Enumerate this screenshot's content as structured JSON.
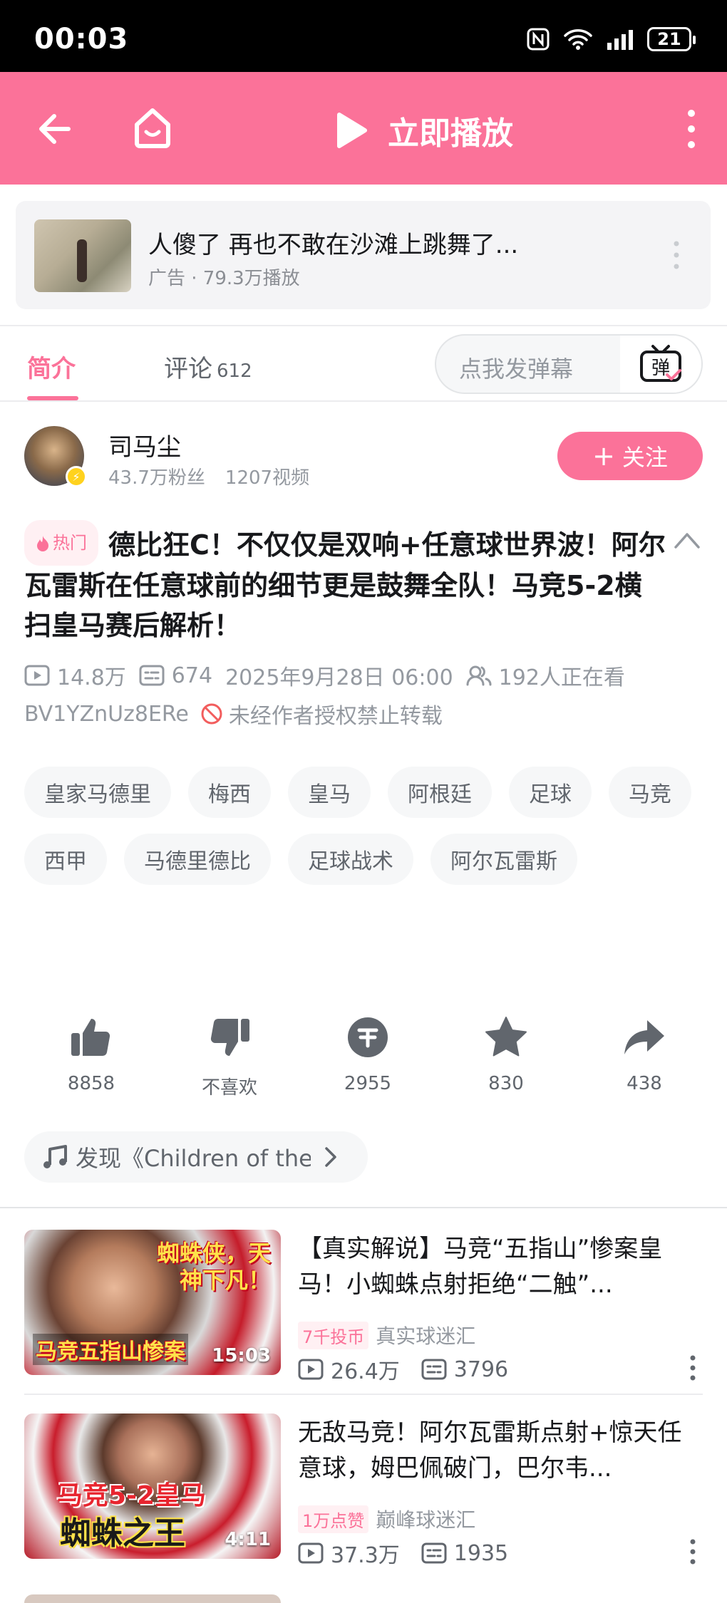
{
  "status_bar": {
    "time": "00:03",
    "battery": "21"
  },
  "header": {
    "play_label": "立即播放"
  },
  "ad": {
    "title": "人傻了 再也不敢在沙滩上跳舞了...",
    "meta": "广告 · 79.3万播放"
  },
  "tabs": {
    "intro": "简介",
    "comments": "评论",
    "comments_count": "612"
  },
  "danmaku": {
    "placeholder": "点我发弹幕",
    "button_glyph": "弹"
  },
  "uploader": {
    "name": "司马尘",
    "fans": "43.7万粉丝",
    "videos": "1207视频",
    "follow_label": "关注"
  },
  "video": {
    "hot_label": "热门",
    "title": "德比狂C！不仅仅是双响+任意球世界波！阿尔瓦雷斯在任意球前的细节更是鼓舞全队！马竞5-2横扫皇马赛后解析！",
    "plays": "14.8万",
    "danmaku_count": "674",
    "date": "2025年9月28日 06:00",
    "watching": "192人正在看",
    "bvid": "BV1YZnUz8ERe",
    "copyright": "未经作者授权禁止转载"
  },
  "tags": [
    "皇家马德里",
    "梅西",
    "皇马",
    "阿根廷",
    "足球",
    "马竞",
    "西甲",
    "马德里德比",
    "足球战术",
    "阿尔瓦雷斯"
  ],
  "actions": {
    "like": "8858",
    "dislike": "不喜欢",
    "coin": "2955",
    "favorite": "830",
    "share": "438"
  },
  "music": {
    "label": "发现《Children of the"
  },
  "related": [
    {
      "title": "【真实解说】马竞“五指山”惨案皇马！小蜘蛛点射拒绝“二触”...",
      "badge": "7千投币",
      "author": "真实球迷汇",
      "plays": "26.4万",
      "danmaku": "3796",
      "duration": "15:03",
      "cover_text_top": "蜘蛛侠，天神下凡！",
      "cover_text_bottom": "马竞五指山惨案"
    },
    {
      "title": "无敌马竞！阿尔瓦雷斯点射+惊天任意球，姆巴佩破门，巴尔韦...",
      "badge": "1万点赞",
      "author": "巅峰球迷汇",
      "plays": "37.3万",
      "danmaku": "1935",
      "duration": "4:11",
      "cover_text_top": "马竞5-2皇马",
      "cover_text_bottom": "蜘蛛之王"
    }
  ],
  "colors": {
    "brand_pink": "#fb7299",
    "status_bar": "#000000",
    "text_primary": "#18191c",
    "text_secondary": "#9499a0"
  }
}
